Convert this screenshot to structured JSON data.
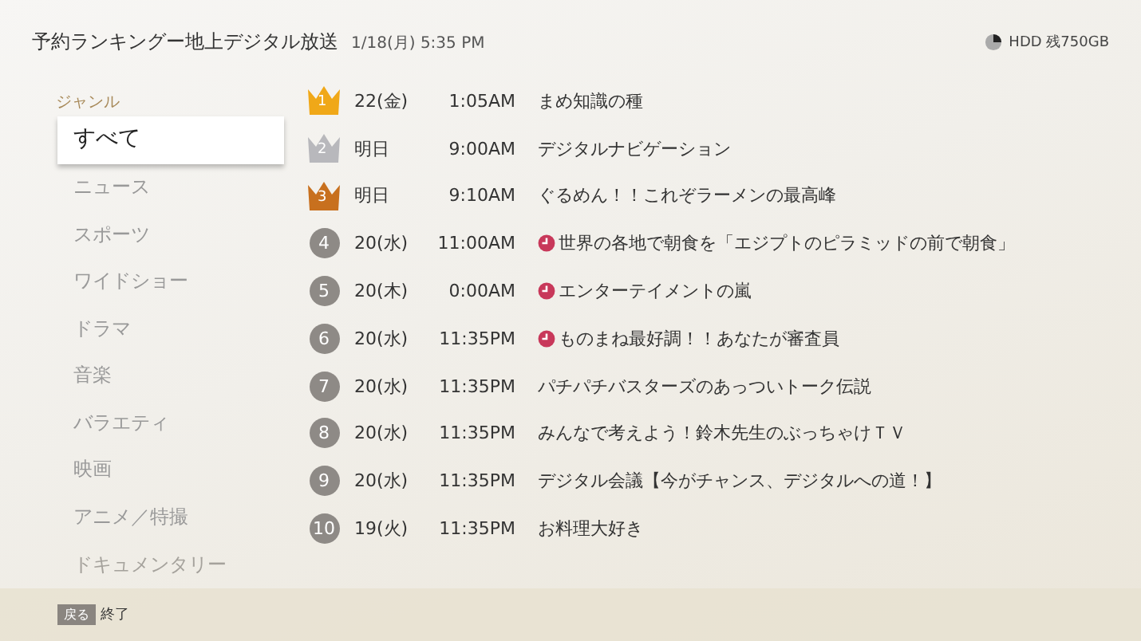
{
  "header": {
    "title": "予約ランキングー地上デジタル放送",
    "datetime": "1/18(月) 5:35 PM",
    "storage": "HDD 残750GB"
  },
  "sidebar": {
    "heading": "ジャンル",
    "items": [
      {
        "label": "すべて",
        "selected": true
      },
      {
        "label": "ニュース",
        "selected": false
      },
      {
        "label": "スポーツ",
        "selected": false
      },
      {
        "label": "ワイドショー",
        "selected": false
      },
      {
        "label": "ドラマ",
        "selected": false
      },
      {
        "label": "音楽",
        "selected": false
      },
      {
        "label": "バラエティ",
        "selected": false
      },
      {
        "label": "映画",
        "selected": false
      },
      {
        "label": "アニメ／特撮",
        "selected": false
      },
      {
        "label": "ドキュメンタリー",
        "selected": false
      }
    ]
  },
  "rankings": [
    {
      "rank": "1",
      "kind": "crown",
      "color": "#f0a818",
      "date": "22(金)",
      "time": "1:05AM",
      "title": "まめ知識の種",
      "reserved": false
    },
    {
      "rank": "2",
      "kind": "crown",
      "color": "#b8b8bc",
      "date": "明日",
      "time": "9:00AM",
      "title": "デジタルナビゲーション",
      "reserved": false
    },
    {
      "rank": "3",
      "kind": "crown",
      "color": "#c8701e",
      "date": "明日",
      "time": "9:10AM",
      "title": "ぐるめん！！これぞラーメンの最高峰",
      "reserved": false
    },
    {
      "rank": "4",
      "kind": "circle",
      "date": "20(水)",
      "time": "11:00AM",
      "title": "世界の各地で朝食を「エジプトのピラミッドの前で朝食」",
      "reserved": true
    },
    {
      "rank": "5",
      "kind": "circle",
      "date": "20(木)",
      "time": "0:00AM",
      "title": "エンターテイメントの嵐",
      "reserved": true
    },
    {
      "rank": "6",
      "kind": "circle",
      "date": "20(水)",
      "time": "11:35PM",
      "title": "ものまね最好調！！あなたが審査員",
      "reserved": true
    },
    {
      "rank": "7",
      "kind": "circle",
      "date": "20(水)",
      "time": "11:35PM",
      "title": "パチパチバスターズのあっついトーク伝説",
      "reserved": false
    },
    {
      "rank": "8",
      "kind": "circle",
      "date": "20(水)",
      "time": "11:35PM",
      "title": "みんなで考えよう！鈴木先生のぶっちゃけＴＶ",
      "reserved": false
    },
    {
      "rank": "9",
      "kind": "circle",
      "date": "20(水)",
      "time": "11:35PM",
      "title": "デジタル会議【今がチャンス、デジタルへの道！】",
      "reserved": false
    },
    {
      "rank": "10",
      "kind": "circle",
      "date": "19(火)",
      "time": "11:35PM",
      "title": "お料理大好き",
      "reserved": false
    }
  ],
  "footer": {
    "key": "戻る",
    "action": "終了"
  }
}
